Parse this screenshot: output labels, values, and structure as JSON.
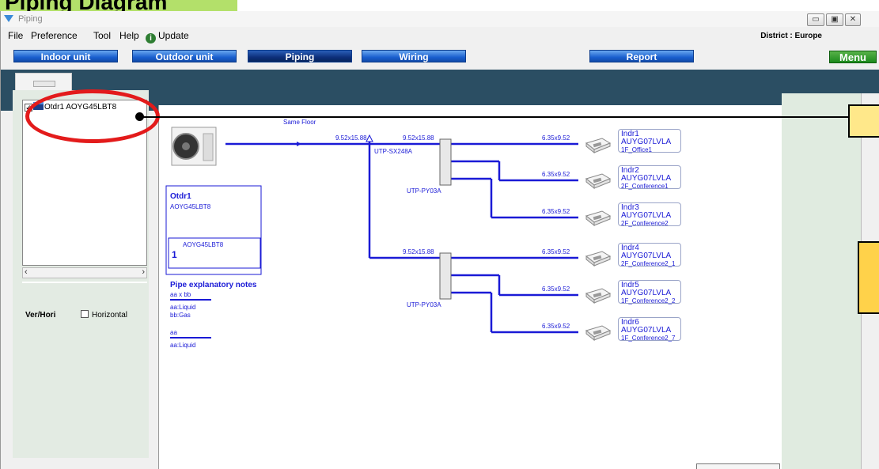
{
  "banner": {
    "text": "Piping Diagram"
  },
  "window": {
    "title": "Piping"
  },
  "menu": {
    "file": "File",
    "preference": "Preference",
    "tool": "Tool",
    "help": "Help",
    "update": "Update"
  },
  "district": "District : Europe",
  "nav": {
    "indoor": "Indoor unit",
    "outdoor": "Outdoor unit",
    "piping": "Piping",
    "wiring": "Wiring",
    "report": "Report",
    "menu": "Menu"
  },
  "tree": {
    "item": "Otdr1 AOYG45LBT8"
  },
  "panel": {
    "ver_label": "Ver/Hori",
    "horizontal": "Horizontal"
  },
  "diagram": {
    "same_floor": "Same Floor",
    "main_pipe": "9.52x15.88",
    "branch_pipe_1": "9.52x15.88",
    "branch_pipe_2": "9.52x15.88",
    "joint_1": "UTP-SX248A",
    "header_1": "UTP-PY03A",
    "header_2": "UTP-PY03A",
    "outdoor_name": "Otdr1",
    "outdoor_model": "AOYG45LBT8",
    "outdoor_unit_model": "AOYG45LBT8",
    "outdoor_unit_count": "1",
    "notes_title": "Pipe explanatory notes",
    "notes": [
      "aa x bb",
      "aa:Liquid",
      "bb:Gas",
      "aa",
      "aa:Liquid"
    ],
    "indoor_pipe": "6.35x9.52",
    "indoors": [
      {
        "name": "Indr1",
        "model": "AUYG07LVLA",
        "room": "1F_Office1"
      },
      {
        "name": "Indr2",
        "model": "AUYG07LVLA",
        "room": "2F_Conference1"
      },
      {
        "name": "Indr3",
        "model": "AUYG07LVLA",
        "room": "2F_Conference2"
      },
      {
        "name": "Indr4",
        "model": "AUYG07LVLA",
        "room": "2F_Conference2_1"
      },
      {
        "name": "Indr5",
        "model": "AUYG07LVLA",
        "room": "1F_Conference2_2"
      },
      {
        "name": "Indr6",
        "model": "AUYG07LVLA",
        "room": "1F_Conference2_7"
      }
    ]
  },
  "colors": {
    "pipe": "#1a1ad6",
    "nav_blue": "#1a5fcf",
    "menu_green": "#1c8a1c",
    "highlight": "#e31b1b",
    "note": "#ffe88a"
  }
}
